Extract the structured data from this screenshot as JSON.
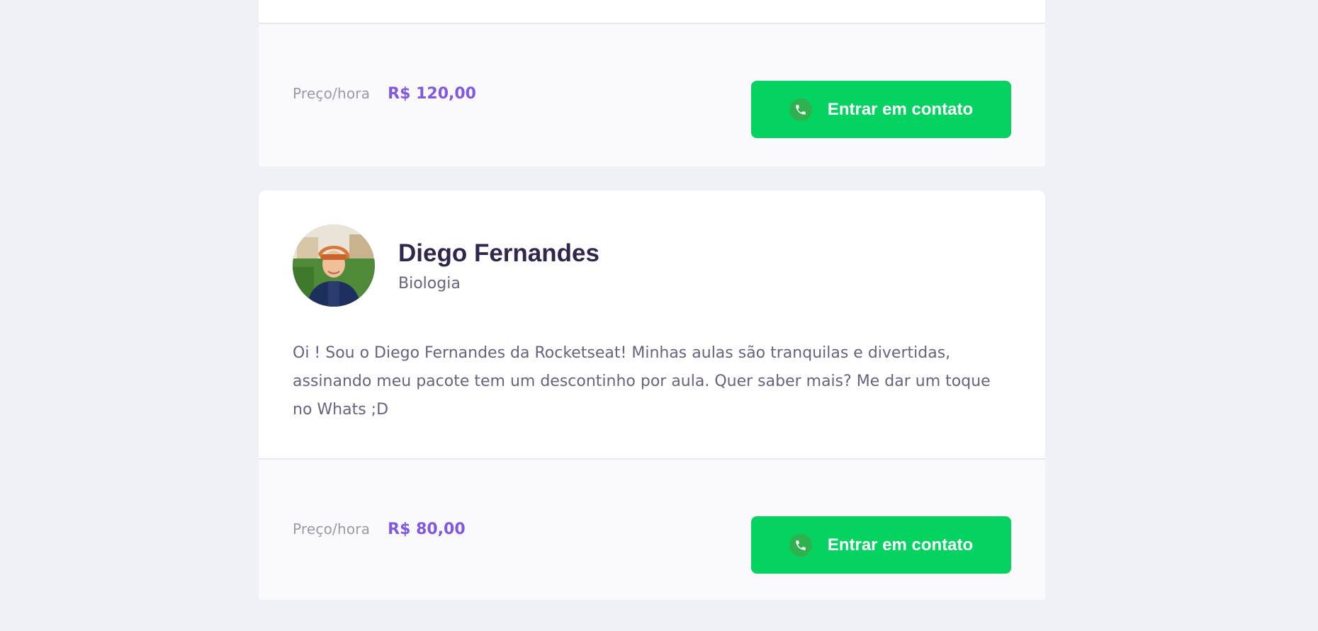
{
  "cards": [
    {
      "price_label": "Preço/hora",
      "price_value": "R$ 120,00",
      "contact_label": "Entrar em contato"
    },
    {
      "teacher": {
        "name": "Diego Fernandes",
        "subject": "Biologia",
        "bio": "Oi ! Sou o Diego Fernandes da Rocketseat! Minhas aulas são tranquilas e divertidas, assinando meu pacote tem um descontinho por aula. Quer saber mais? Me dar um toque no Whats ;D"
      },
      "price_label": "Preço/hora",
      "price_value": "R$ 80,00",
      "contact_label": "Entrar em contato"
    }
  ],
  "icons": {
    "contact": "phone-icon",
    "avatar": "avatar"
  },
  "colors": {
    "page_bg": "#f0f0f7",
    "card_bg": "#ffffff",
    "footer_bg": "#fafafc",
    "accent_purple": "#8257e5",
    "button_green": "#04d361",
    "title": "#32264d",
    "text": "#6a6180"
  }
}
